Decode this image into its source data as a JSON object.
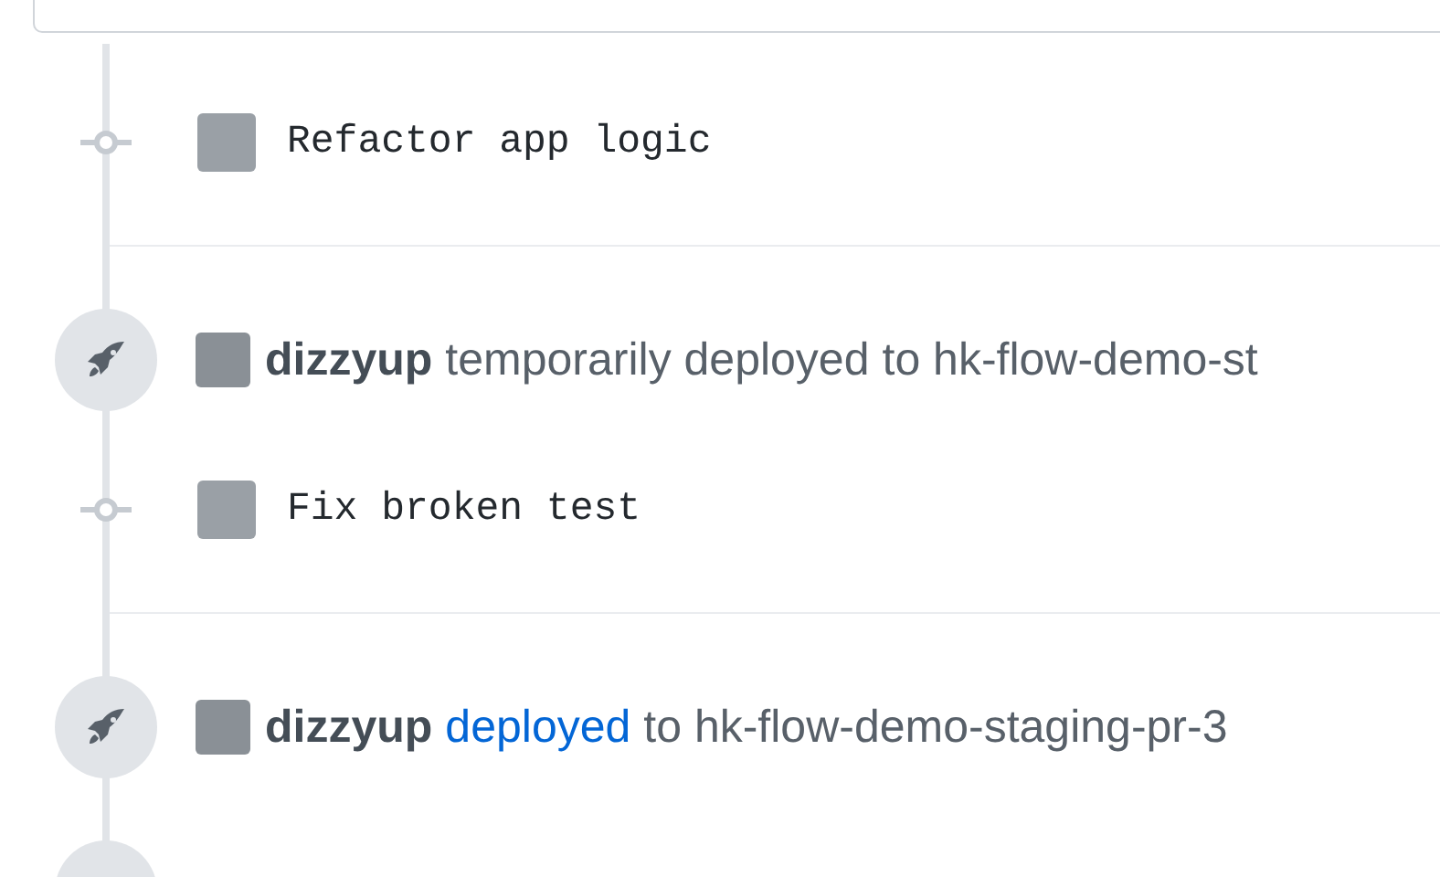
{
  "timeline": [
    {
      "kind": "commit",
      "message": "Refactor app logic"
    },
    {
      "kind": "deploy",
      "actor": "dizzyup",
      "action": "temporarily deployed",
      "action_link": false,
      "rest": "to hk-flow-demo-st"
    },
    {
      "kind": "commit",
      "message": "Fix broken test"
    },
    {
      "kind": "deploy",
      "actor": "dizzyup",
      "action": "deployed",
      "action_link": true,
      "rest": "to hk-flow-demo-staging-pr-3"
    }
  ]
}
